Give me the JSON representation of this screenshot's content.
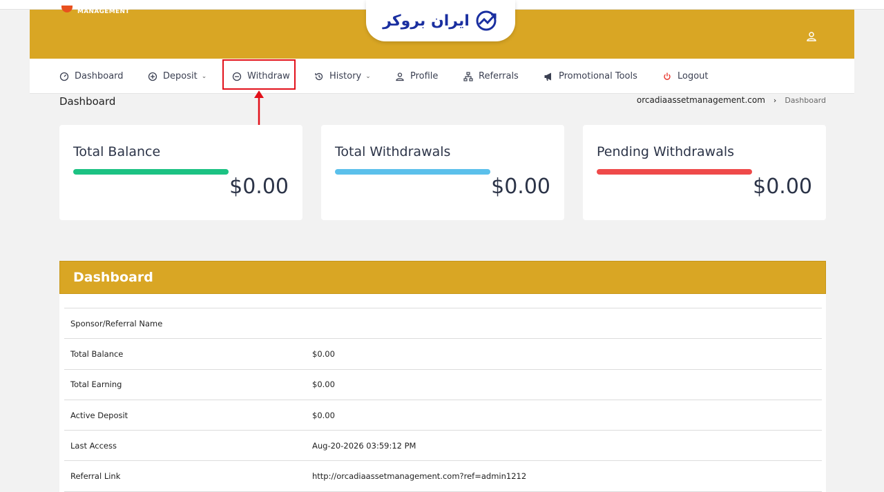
{
  "brand": {
    "logo_text": "MANAGEMENT",
    "watermark": "ایران بروکر"
  },
  "nav": {
    "items": [
      {
        "label": "Dashboard",
        "icon": "speedometer-icon"
      },
      {
        "label": "Deposit",
        "icon": "plus-circle-icon"
      },
      {
        "label": "Withdraw",
        "icon": "minus-circle-icon"
      },
      {
        "label": "History",
        "icon": "history-icon"
      },
      {
        "label": "Profile",
        "icon": "user-icon"
      },
      {
        "label": "Referrals",
        "icon": "network-icon"
      },
      {
        "label": "Promotional Tools",
        "icon": "megaphone-icon"
      },
      {
        "label": "Logout",
        "icon": "power-icon"
      }
    ]
  },
  "page": {
    "title": "Dashboard"
  },
  "breadcrumb": {
    "site": "orcadiaassetmanagement.com",
    "current": "Dashboard"
  },
  "cards": [
    {
      "title": "Total Balance",
      "amount": "$0.00",
      "color": "#1cc283"
    },
    {
      "title": "Total Withdrawals",
      "amount": "$0.00",
      "color": "#5bc0eb"
    },
    {
      "title": "Pending Withdrawals",
      "amount": "$0.00",
      "color": "#ef4a4a"
    }
  ],
  "panel": {
    "title": "Dashboard",
    "rows": [
      {
        "key": "Sponsor/Referral Name",
        "value": ""
      },
      {
        "key": "Total Balance",
        "value": "$0.00"
      },
      {
        "key": "Total Earning",
        "value": "$0.00"
      },
      {
        "key": "Active Deposit",
        "value": "$0.00"
      },
      {
        "key": "Last Access",
        "value": "Aug-20-2026 03:59:12 PM"
      },
      {
        "key": "Referral Link",
        "value": "http://orcadiaassetmanagement.com?ref=admin1212"
      }
    ]
  },
  "colors": {
    "header": "#d9a624",
    "highlight": "#e2101a",
    "logout_icon": "#e8332a"
  }
}
